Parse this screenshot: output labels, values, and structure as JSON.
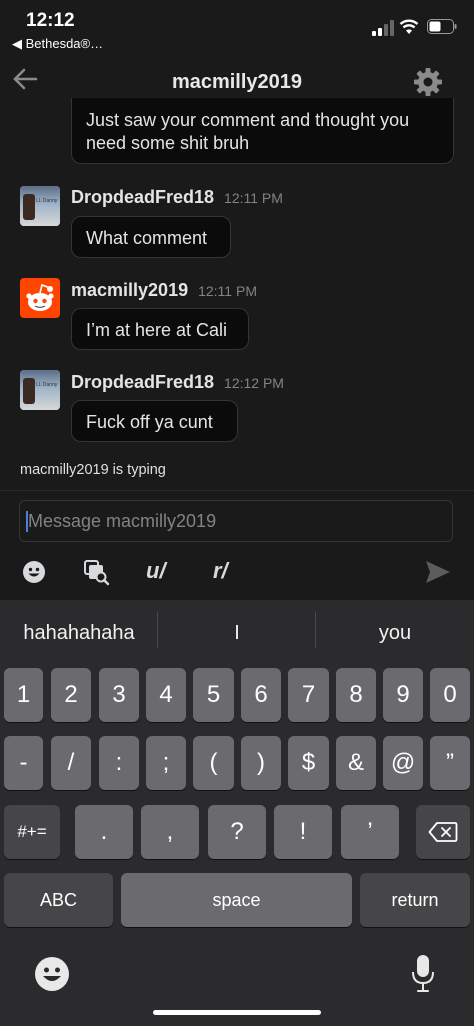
{
  "status_bar": {
    "time": "12:12",
    "back_app": "◀ Bethesda®…"
  },
  "header": {
    "title": "macmilly2019"
  },
  "messages": [
    {
      "text": "Just saw your comment and thought you need some shit bruh"
    },
    {
      "user": "DropdeadFred18",
      "time": "12:11 PM",
      "text": "What comment"
    },
    {
      "user": "macmilly2019",
      "time": "12:11 PM",
      "text": "I’m at here at Cali"
    },
    {
      "user": "DropdeadFred18",
      "time": "12:12 PM",
      "text": "Fuck off ya cunt"
    }
  ],
  "avatar_text": "LL Danny",
  "typing_indicator": "macmilly2019 is typing",
  "composer": {
    "placeholder": "Message macmilly2019",
    "user_tool": "u/",
    "subreddit_tool": "r/"
  },
  "keyboard": {
    "suggestions": [
      "hahahahaha",
      "I",
      "you"
    ],
    "row1": [
      "1",
      "2",
      "3",
      "4",
      "5",
      "6",
      "7",
      "8",
      "9",
      "0"
    ],
    "row2": [
      "-",
      "/",
      ":",
      ";",
      "(",
      ")",
      "$",
      "&",
      "@",
      "”"
    ],
    "row3": {
      "shift": "#+=",
      "keys": [
        ".",
        ",",
        "?",
        "!",
        "’"
      ]
    },
    "row4": {
      "abc": "ABC",
      "space": "space",
      "return": "return"
    }
  },
  "colors": {
    "background": "#1a1a1b",
    "bubble": "#0b0b0b",
    "bubble_border": "#343536",
    "caret": "#4f7dde",
    "reddit_orange": "#ff4500"
  }
}
